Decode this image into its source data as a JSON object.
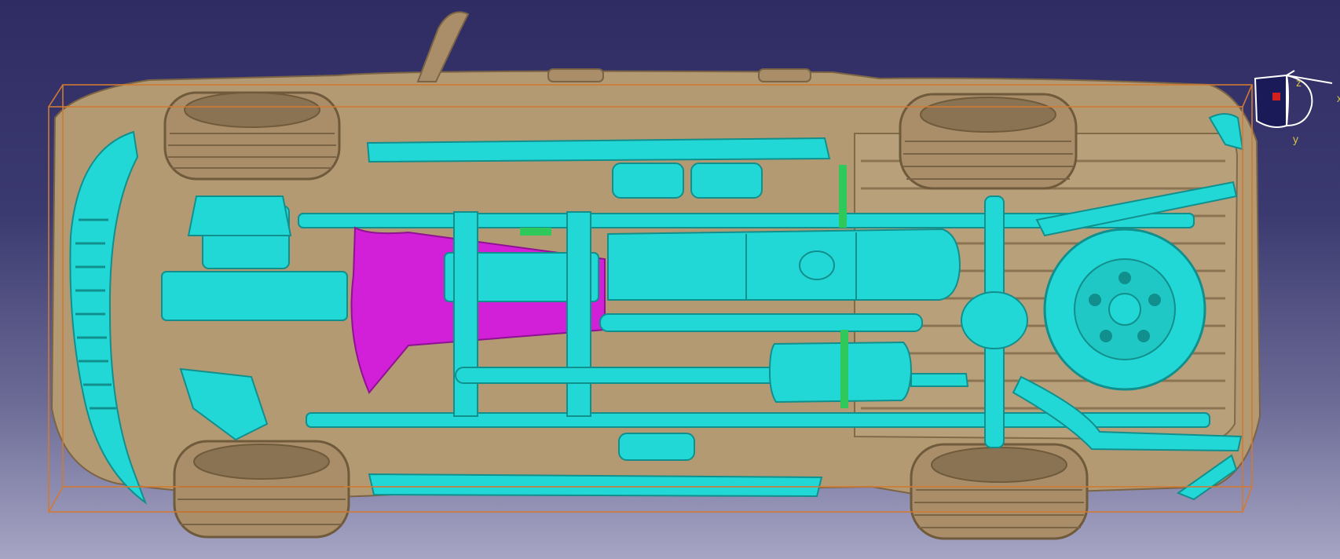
{
  "window": {
    "title": ""
  },
  "viewport": {
    "background_top": "#2f2c63",
    "background_bottom": "#a6a5c4",
    "bounding_box_color": "#d07a33",
    "body_color": "#b39a72",
    "tire_color": "#a98e69",
    "component_color": "#22d8d6",
    "highlight_color": "#d21fd8",
    "accent_green": "#2fc85a"
  },
  "compass": {
    "x_label": "x",
    "y_label": "y",
    "z_label": "z",
    "icon": "axis-compass-icon"
  }
}
